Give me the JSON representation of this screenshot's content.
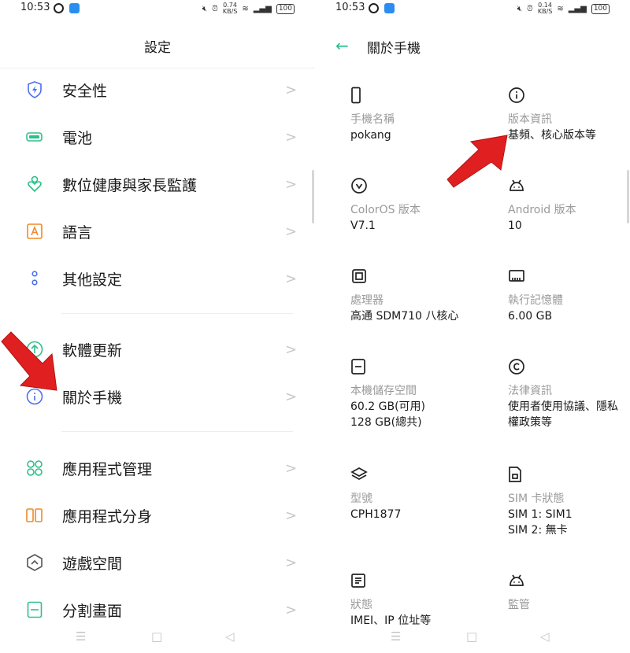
{
  "left": {
    "status": {
      "time": "10:53",
      "speed_top": "0.74",
      "speed_bottom": "KB/S",
      "battery": "100"
    },
    "title": "設定",
    "items": [
      {
        "label": "安全性",
        "icon": "shield-icon",
        "color": "#4a6ef0"
      },
      {
        "label": "電池",
        "icon": "battery-icon",
        "color": "#2fbf8b"
      },
      {
        "label": "數位健康與家長監護",
        "icon": "wellbeing-icon",
        "color": "#2fbf8b"
      },
      {
        "label": "語言",
        "icon": "language-icon",
        "color": "#f08a24"
      },
      {
        "label": "其他設定",
        "icon": "more-settings-icon",
        "color": "#4a6ef0"
      },
      {
        "label": "軟體更新",
        "icon": "update-icon",
        "color": "#2fbf8b"
      },
      {
        "label": "關於手機",
        "icon": "info-icon",
        "color": "#4a6ef0"
      },
      {
        "label": "應用程式管理",
        "icon": "apps-icon",
        "color": "#2fbf8b"
      },
      {
        "label": "應用程式分身",
        "icon": "clone-icon",
        "color": "#f08a24"
      },
      {
        "label": "遊戲空間",
        "icon": "game-icon",
        "color": "#555555"
      },
      {
        "label": "分割畫面",
        "icon": "split-screen-icon",
        "color": "#2fbf8b"
      }
    ],
    "chevron": ">"
  },
  "right": {
    "status": {
      "time": "10:53",
      "speed_top": "0.14",
      "speed_bottom": "KB/S",
      "battery": "100"
    },
    "back": "←",
    "title": "關於手機",
    "cells": [
      {
        "title": "手機名稱",
        "value": "pokang",
        "icon": "phone-icon"
      },
      {
        "title": "版本資訊",
        "value": "基頻、核心版本等",
        "icon": "info-circle-icon"
      },
      {
        "title": "ColorOS 版本",
        "value": "V7.1",
        "icon": "coloros-icon"
      },
      {
        "title": "Android 版本",
        "value": "10",
        "icon": "android-icon"
      },
      {
        "title": "處理器",
        "value": "高通 SDM710 八核心",
        "icon": "cpu-icon"
      },
      {
        "title": "執行記憶體",
        "value": "6.00 GB",
        "icon": "ram-icon"
      },
      {
        "title": "本機儲存空間",
        "value": "60.2 GB(可用)\n128 GB(總共)",
        "icon": "storage-icon"
      },
      {
        "title": "法律資訊",
        "value": "使用者使用協議、隱私\n權政策等",
        "icon": "copyright-icon"
      },
      {
        "title": "型號",
        "value": "CPH1877",
        "icon": "layers-icon"
      },
      {
        "title": "SIM 卡狀態",
        "value": "SIM 1: SIM1\nSIM 2: 無卡",
        "icon": "sim-icon"
      },
      {
        "title": "狀態",
        "value": "IMEI、IP 位址等",
        "icon": "status-icon"
      },
      {
        "title": "監管",
        "value": "",
        "icon": "regulatory-icon"
      }
    ]
  },
  "nav": {
    "menu": "☰",
    "home": "□",
    "back": "◁"
  }
}
